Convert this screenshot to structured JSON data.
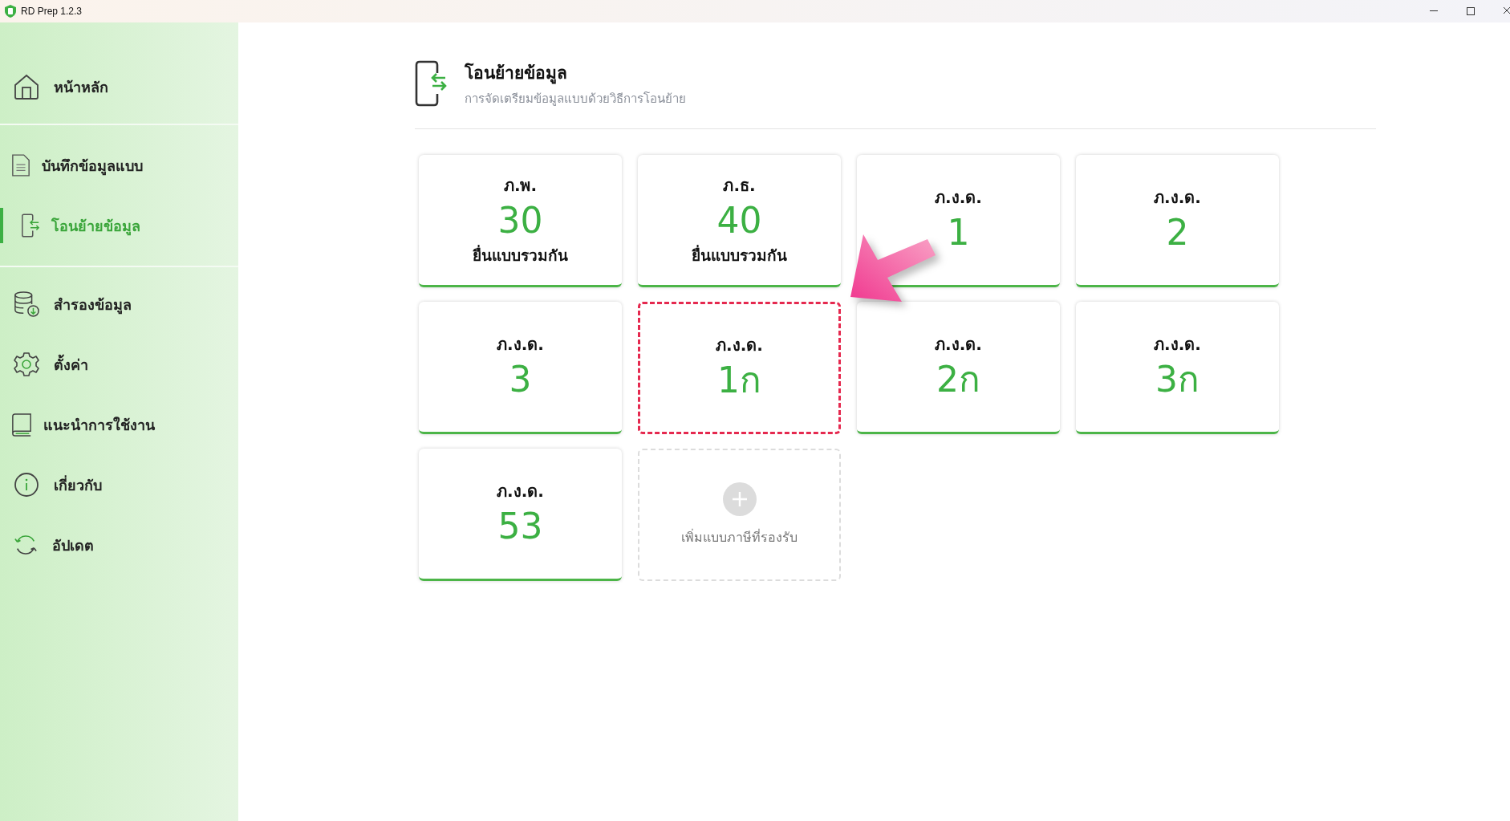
{
  "window": {
    "title": "RD Prep 1.2.3"
  },
  "sidebar": {
    "groups": [
      {
        "items": [
          {
            "label": "หน้าหลัก",
            "selected": false
          }
        ]
      },
      {
        "items": [
          {
            "label": "บันทึกข้อมูลแบบ",
            "selected": false
          },
          {
            "label": "โอนย้ายข้อมูล",
            "selected": true
          }
        ]
      },
      {
        "items": [
          {
            "label": "สำรองข้อมูล",
            "selected": false
          },
          {
            "label": "ตั้งค่า",
            "selected": false
          },
          {
            "label": "แนะนำการใช้งาน",
            "selected": false
          },
          {
            "label": "เกี่ยวกับ",
            "selected": false
          },
          {
            "label": "อัปเดต",
            "selected": false
          }
        ]
      }
    ]
  },
  "page": {
    "title": "โอนย้ายข้อมูล",
    "subtitle": "การจัดเตรียมข้อมูลแบบด้วยวิธีการโอนย้าย"
  },
  "cards": [
    {
      "form": "ภ.พ.",
      "number": "30",
      "note": "ยื่นแบบรวมกัน",
      "highlighted": false
    },
    {
      "form": "ภ.ธ.",
      "number": "40",
      "note": "ยื่นแบบรวมกัน",
      "highlighted": false
    },
    {
      "form": "ภ.ง.ด.",
      "number": "1",
      "highlighted": false
    },
    {
      "form": "ภ.ง.ด.",
      "number": "2",
      "highlighted": false
    },
    {
      "form": "ภ.ง.ด.",
      "number": "3",
      "highlighted": false
    },
    {
      "form": "ภ.ง.ด.",
      "number": "1ก",
      "highlighted": true
    },
    {
      "form": "ภ.ง.ด.",
      "number": "2ก",
      "highlighted": false
    },
    {
      "form": "ภ.ง.ด.",
      "number": "3ก",
      "highlighted": false
    },
    {
      "form": "ภ.ง.ด.",
      "number": "53",
      "highlighted": false
    }
  ],
  "add_card": {
    "label": "เพิ่มแบบภาษีที่รองรับ"
  }
}
